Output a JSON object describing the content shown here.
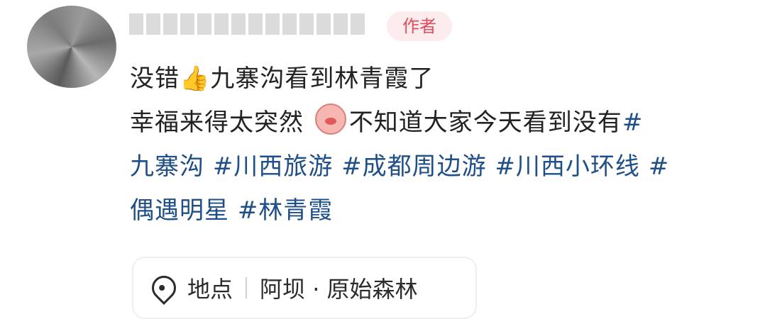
{
  "comment": {
    "author_badge": "作者",
    "lines": [
      {
        "segments": [
          {
            "text": "没错",
            "type": "text"
          },
          {
            "text": "👍",
            "type": "emoji"
          },
          {
            "text": "九寨沟看到林青霞了",
            "type": "text"
          }
        ]
      },
      {
        "segments": [
          {
            "text": "幸福来得太突然 ",
            "type": "text"
          },
          {
            "text": "",
            "type": "pig-emoji"
          },
          {
            "text": "不知道大家今天看到没有",
            "type": "text"
          },
          {
            "text": "#",
            "type": "hashtag"
          }
        ]
      },
      {
        "segments": [
          {
            "text": "九寨沟 ",
            "type": "hashtag"
          },
          {
            "text": "#川西旅游 ",
            "type": "hashtag"
          },
          {
            "text": "#成都周边游 ",
            "type": "hashtag"
          },
          {
            "text": "#川西小环线 ",
            "type": "hashtag"
          },
          {
            "text": "#",
            "type": "hashtag"
          }
        ]
      },
      {
        "segments": [
          {
            "text": "偶遇明星 ",
            "type": "hashtag"
          },
          {
            "text": "#林青霞",
            "type": "hashtag"
          }
        ]
      }
    ]
  },
  "location": {
    "icon": "location-pin-icon",
    "label": "地点",
    "value": "阿坝 · 原始森林"
  },
  "colors": {
    "hashtag": "#1f4f88",
    "badge_bg": "#fdecee",
    "badge_text": "#e04d5f"
  }
}
